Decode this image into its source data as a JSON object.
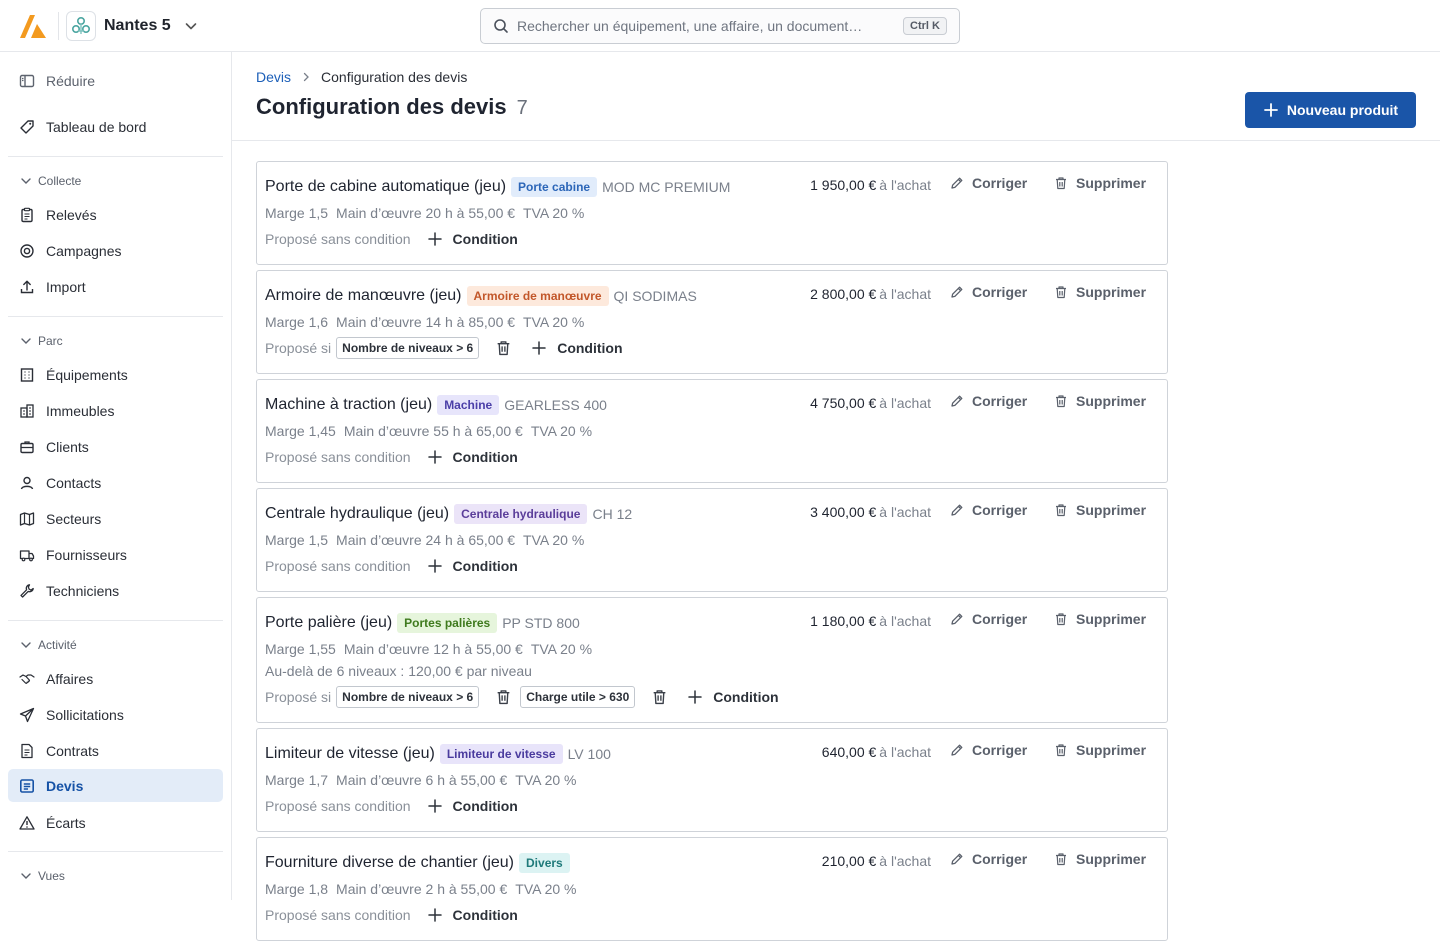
{
  "header": {
    "org_name": "Nantes 5",
    "search_placeholder": "Rechercher un équipement, une affaire, un document…",
    "search_shortcut": "Ctrl K",
    "colors": {
      "brand": "#f39a1f",
      "primary": "#1a55a8"
    }
  },
  "sidebar": {
    "collapse_label": "Réduire",
    "dashboard_label": "Tableau de bord",
    "sections": {
      "collecte": "Collecte",
      "parc": "Parc",
      "activite": "Activité",
      "vues": "Vues"
    },
    "items": {
      "releves": "Relevés",
      "campagnes": "Campagnes",
      "import": "Import",
      "equipements": "Équipements",
      "immeubles": "Immeubles",
      "clients": "Clients",
      "contacts": "Contacts",
      "secteurs": "Secteurs",
      "fournisseurs": "Fournisseurs",
      "techniciens": "Techniciens",
      "affaires": "Affaires",
      "sollicitations": "Sollicitations",
      "contrats": "Contrats",
      "devis": "Devis",
      "ecarts": "Écarts"
    },
    "active": "devis"
  },
  "page": {
    "breadcrumb_root": "Devis",
    "breadcrumb_current": "Configuration des devis",
    "title": "Configuration des devis",
    "count": "7",
    "new_button": "Nouveau produit"
  },
  "labels": {
    "edit": "Corriger",
    "delete": "Supprimer",
    "add_condition": "Condition",
    "purchase_suffix": "à l'achat",
    "proposed_if": "Proposé si",
    "proposed_none": "Proposé sans condition"
  },
  "products": [
    {
      "name": "Porte de cabine automatique (jeu)",
      "tag": "Porte cabine",
      "tag_bg": "#e1ecfb",
      "tag_fg": "#2c66b8",
      "ref": "MOD MC PREMIUM",
      "price": "1 950,00 €",
      "margin": "Marge 1,5",
      "labor": "Main d’œuvre 20 h à 55,00 €",
      "vat": "TVA 20 %",
      "note": "",
      "conditions": []
    },
    {
      "name": "Armoire de manœuvre (jeu)",
      "tag": "Armoire de manœuvre",
      "tag_bg": "#fde9dc",
      "tag_fg": "#c2572a",
      "ref": "QI SODIMAS",
      "price": "2 800,00 €",
      "margin": "Marge 1,6",
      "labor": "Main d’œuvre 14 h à 85,00 €",
      "vat": "TVA 20 %",
      "note": "",
      "conditions": [
        "Nombre de niveaux > 6"
      ]
    },
    {
      "name": "Machine à traction (jeu)",
      "tag": "Machine",
      "tag_bg": "#e7e5fb",
      "tag_fg": "#4b3fa8",
      "ref": "GEARLESS 400",
      "price": "4 750,00 €",
      "margin": "Marge 1,45",
      "labor": "Main d’œuvre 55 h à 65,00 €",
      "vat": "TVA 20 %",
      "note": "",
      "conditions": []
    },
    {
      "name": "Centrale hydraulique (jeu)",
      "tag": "Centrale hydraulique",
      "tag_bg": "#ebe4f8",
      "tag_fg": "#5b3e9a",
      "ref": "CH 12",
      "price": "3 400,00 €",
      "margin": "Marge 1,5",
      "labor": "Main d’œuvre 24 h à 65,00 €",
      "vat": "TVA 20 %",
      "note": "",
      "conditions": []
    },
    {
      "name": "Porte palière (jeu)",
      "tag": "Portes palières",
      "tag_bg": "#e6f5dc",
      "tag_fg": "#3f7a1e",
      "ref": "PP STD 800",
      "price": "1 180,00 €",
      "margin": "Marge 1,55",
      "labor": "Main d’œuvre 12 h à 55,00 €",
      "vat": "TVA 20 %",
      "note": "Au-delà de 6 niveaux : 120,00 € par niveau",
      "conditions": [
        "Nombre de niveaux > 6",
        "Charge utile > 630"
      ]
    },
    {
      "name": "Limiteur de vitesse (jeu)",
      "tag": "Limiteur de vitesse",
      "tag_bg": "#e8e4fa",
      "tag_fg": "#4a3b9e",
      "ref": "LV 100",
      "price": "640,00 €",
      "margin": "Marge 1,7",
      "labor": "Main d’œuvre 6 h à 55,00 €",
      "vat": "TVA 20 %",
      "note": "",
      "conditions": []
    },
    {
      "name": "Fourniture diverse de chantier (jeu)",
      "tag": "Divers",
      "tag_bg": "#dcf3f3",
      "tag_fg": "#1f7a7a",
      "ref": "",
      "price": "210,00 €",
      "margin": "Marge 1,8",
      "labor": "Main d’œuvre 2 h à 55,00 €",
      "vat": "TVA 20 %",
      "note": "",
      "conditions": []
    }
  ]
}
